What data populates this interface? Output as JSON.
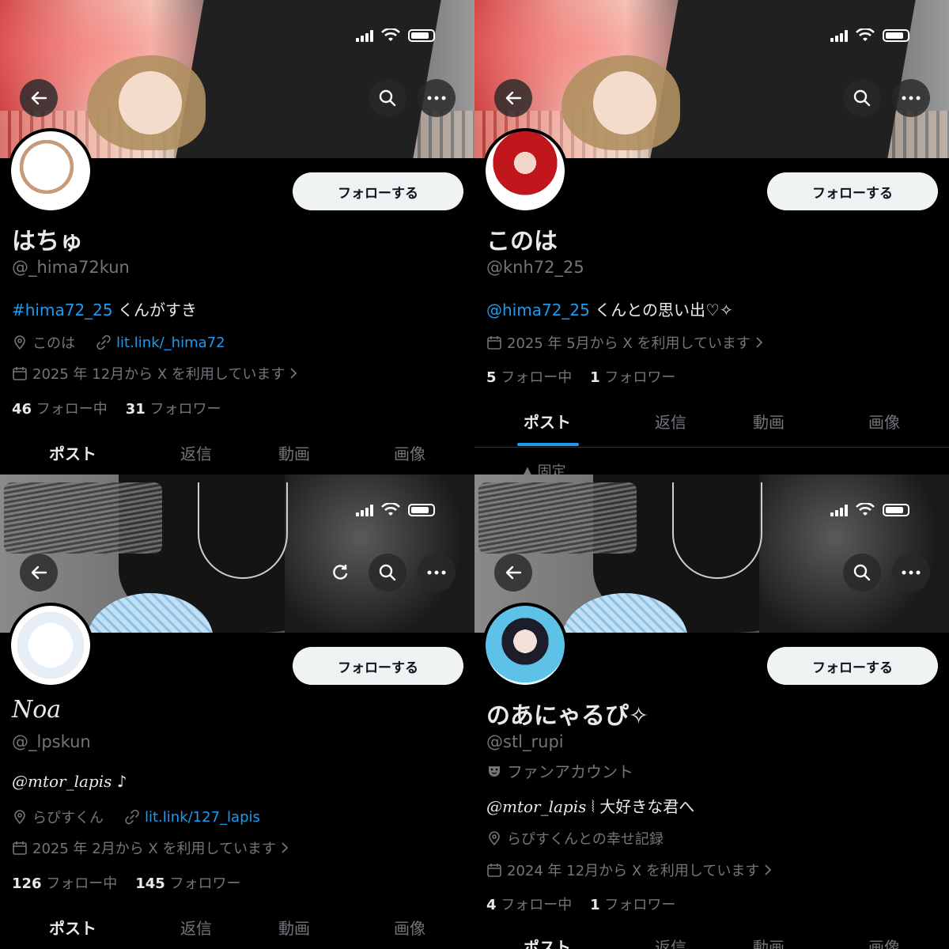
{
  "common": {
    "follow_label": "フォローする",
    "tabs": [
      "ポスト",
      "返信",
      "動画",
      "画像"
    ],
    "following_suffix": "フォロー中",
    "followers_suffix": "フォロワー"
  },
  "profiles": [
    {
      "name": "はちゅ",
      "handle": "@_hima72kun",
      "bio_link": "#hima72_25",
      "bio_text": " くんがすき",
      "location": "このは",
      "website": "lit.link/_hima72",
      "joined": "2025 年 12月から X を利用しています",
      "following": "46",
      "followers": "31"
    },
    {
      "name": "このは",
      "handle": "@knh72_25",
      "bio_link": "@hima72_25",
      "bio_text": " くんとの思い出♡✧",
      "joined": "2025 年 5月から X を利用しています",
      "following": "5",
      "followers": "1",
      "pinned": "固定"
    },
    {
      "name": "Noa",
      "handle": "@_lpskun",
      "bio_link": "@mtor_lapis",
      "bio_text": " ♪",
      "location": "らぴすくん",
      "website": "lit.link/127_lapis",
      "joined": "2025 年 2月から X を利用しています",
      "following": "126",
      "followers": "145"
    },
    {
      "name": "のあにゃるぴ✧",
      "handle": "@stl_rupi",
      "category": "ファンアカウント",
      "bio_link": "@mtor_lapis",
      "bio_text": " ⦚ 大好きな君へ",
      "location": "らぴすくんとの幸せ記録",
      "joined": "2024 年 12月から X を利用しています",
      "following": "4",
      "followers": "1"
    }
  ]
}
